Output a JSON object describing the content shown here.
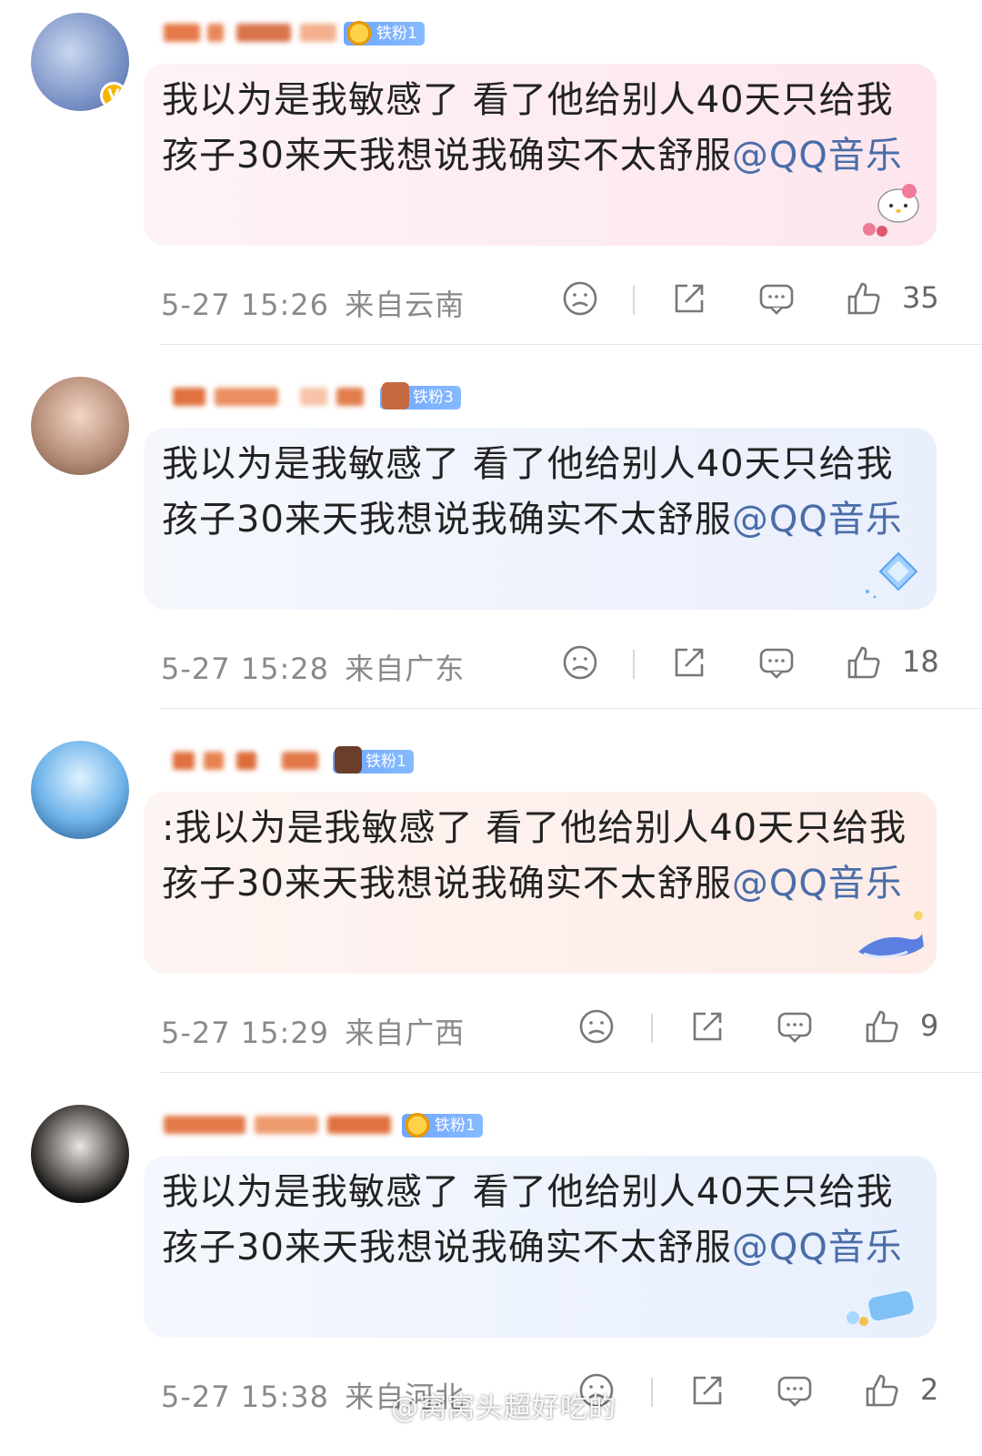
{
  "comments": [
    {
      "fan_badge": "铁粉1",
      "text": "我以为是我敏感了 看了他给别人40天只给我孩子30来天我想说我确实不太舒服",
      "mention": "@QQ音乐",
      "time": "5-27 15:26",
      "location": "来自云南",
      "likes": "35",
      "bubble_color": "#fdeef2",
      "verified": "V"
    },
    {
      "fan_badge": "铁粉3",
      "text": "我以为是我敏感了 看了他给别人40天只给我孩子30来天我想说我确实不太舒服",
      "mention": "@QQ音乐",
      "time": "5-27 15:28",
      "location": "来自广东",
      "likes": "18",
      "bubble_color": "#eef3fd"
    },
    {
      "fan_badge": "铁粉1",
      "text": ":我以为是我敏感了 看了他给别人40天只给我孩子30来天我想说我确实不太舒服",
      "mention": "@QQ音乐",
      "time": "5-27 15:29",
      "location": "来自广西",
      "likes": "9",
      "bubble_color": "#fdf0ee"
    },
    {
      "fan_badge": "铁粉1",
      "text": "我以为是我敏感了 看了他给别人40天只给我孩子30来天我想说我确实不太舒服",
      "mention": "@QQ音乐",
      "time": "5-27 15:38",
      "location": "来自河北",
      "likes": "2",
      "bubble_color": "#eef3fd"
    }
  ],
  "icons": [
    "sad-face-icon",
    "share-icon",
    "comment-icon",
    "thumbs-up-icon"
  ],
  "watermark": "@窝窝头超好吃的"
}
